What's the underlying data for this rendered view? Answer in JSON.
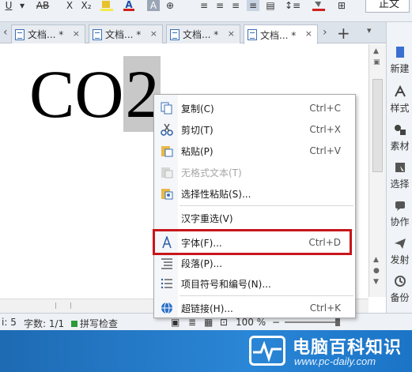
{
  "ribbon": {
    "style_box": "正文"
  },
  "tabs": [
    {
      "label": "文档... *",
      "close": "×"
    },
    {
      "label": "文档... *",
      "close": "×"
    },
    {
      "label": "文档... *",
      "close": "×"
    },
    {
      "label": "文档... *",
      "close": "×"
    }
  ],
  "tab_bar": {
    "new_tab": "+"
  },
  "document": {
    "text": "CO",
    "selected_text": "2"
  },
  "task_pane": {
    "items": [
      "新建",
      "样式",
      "素材",
      "选择",
      "协作",
      "发射",
      "备份"
    ]
  },
  "context_menu": {
    "items": [
      {
        "label": "复制(C)",
        "shortcut": "Ctrl+C",
        "icon": "copy-icon",
        "enabled": true
      },
      {
        "label": "剪切(T)",
        "shortcut": "Ctrl+X",
        "icon": "scissors-icon",
        "enabled": true
      },
      {
        "label": "粘贴(P)",
        "shortcut": "Ctrl+V",
        "icon": "paste-icon",
        "enabled": true
      },
      {
        "label": "无格式文本(T)",
        "shortcut": "",
        "icon": "paste-plain-icon",
        "enabled": false
      },
      {
        "label": "选择性粘贴(S)...",
        "shortcut": "",
        "icon": "paste-special-icon",
        "enabled": true
      },
      {
        "label": "汉字重选(V)",
        "shortcut": "",
        "icon": "",
        "enabled": true
      },
      {
        "label": "字体(F)...",
        "shortcut": "Ctrl+D",
        "icon": "font-icon",
        "enabled": true
      },
      {
        "label": "段落(P)...",
        "shortcut": "",
        "icon": "paragraph-icon",
        "enabled": true
      },
      {
        "label": "项目符号和编号(N)...",
        "shortcut": "",
        "icon": "bullets-icon",
        "enabled": true
      },
      {
        "label": "超链接(H)...",
        "shortcut": "Ctrl+K",
        "icon": "hyperlink-icon",
        "enabled": true
      }
    ]
  },
  "status_bar": {
    "page_fragment": "i: 5",
    "word_count": "字数: 1/1",
    "spell_check": "拼写检查",
    "zoom": "100 %",
    "zoom_minus": "−"
  },
  "banner": {
    "brand": "电脑百科知识",
    "site": "www.pc-daily.com"
  },
  "colors": {
    "highlight_box": "#c8151b",
    "banner": "#2a86d6"
  }
}
